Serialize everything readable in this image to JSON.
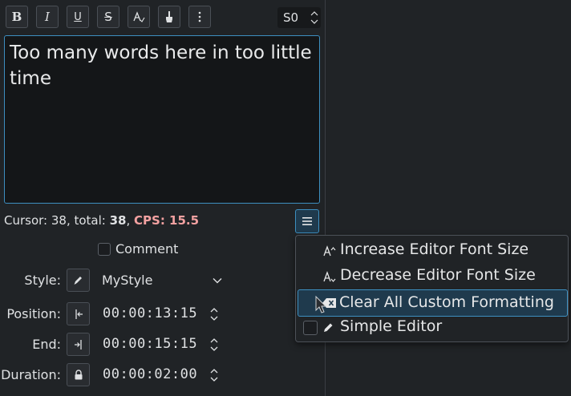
{
  "toolbar": {
    "bold_label": "B",
    "italic_label": "I",
    "underline_label": "U",
    "strike_label": "S",
    "layer_value": "S0"
  },
  "editor": {
    "text": "Too many words here in too little time"
  },
  "status": {
    "cursor_prefix": "Cursor: 38, total: ",
    "total": "38",
    "sep": ", ",
    "cps": "CPS: 15.5"
  },
  "form": {
    "comment_label": "Comment",
    "style_label": "Style:",
    "style_value": "MyStyle",
    "position_label": "Position:",
    "position_value": "00:00:13:15",
    "end_label": "End:",
    "end_value": "00:00:15:15",
    "duration_label": "Duration:",
    "duration_value": "00:00:02:00"
  },
  "menu": {
    "items": [
      {
        "label": "Increase Editor Font Size",
        "icon": "font-increase-icon"
      },
      {
        "label": "Decrease Editor Font Size",
        "icon": "font-decrease-icon"
      },
      {
        "label": "Clear All Custom Formatting",
        "icon": "clear-format-icon"
      },
      {
        "label": "Simple Editor",
        "icon": "pen-icon"
      }
    ]
  },
  "colors": {
    "background": "#202326",
    "accent": "#3d8fc0",
    "selection": "#1f3a4d",
    "cps": "#f3a1a1"
  }
}
